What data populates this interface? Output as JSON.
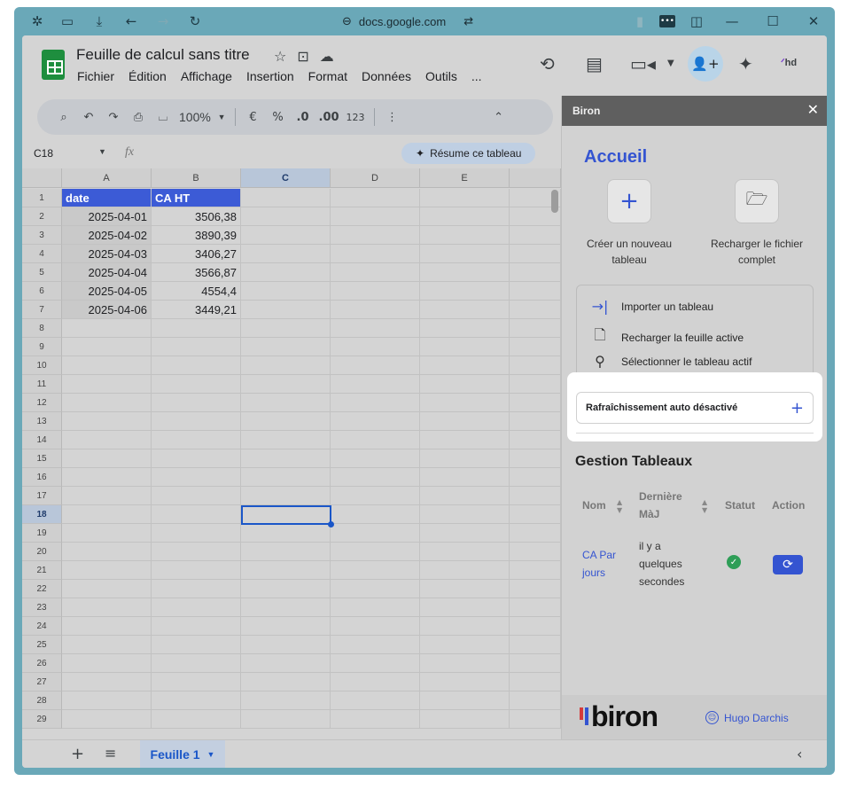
{
  "browser": {
    "url": "docs.google.com"
  },
  "doc": {
    "title": "Feuille de calcul sans titre",
    "menu": [
      "Fichier",
      "Édition",
      "Affichage",
      "Insertion",
      "Format",
      "Données",
      "Outils",
      "..."
    ],
    "hd_label": "hd"
  },
  "toolbar": {
    "zoom": "100%",
    "currency": "€",
    "percent": "%",
    "dec_less": ".0",
    "dec_more": ".00",
    "number_format": "123"
  },
  "formula": {
    "cell_ref": "C18",
    "fx": "fx",
    "summarize": "Résume ce tableau"
  },
  "grid": {
    "columns": [
      "A",
      "B",
      "C",
      "D",
      "E"
    ],
    "selected_column": "C",
    "rows": [
      "1",
      "2",
      "3",
      "4",
      "5",
      "6",
      "7",
      "8",
      "9",
      "10",
      "11",
      "12",
      "13",
      "14",
      "15",
      "16",
      "17",
      "18",
      "19",
      "20",
      "21",
      "22",
      "23",
      "24",
      "25",
      "26",
      "27",
      "28",
      "29"
    ],
    "selected_row": "18",
    "header": [
      "date",
      "CA HT"
    ],
    "data": [
      [
        "2025-04-01",
        "3506,38"
      ],
      [
        "2025-04-02",
        "3890,39"
      ],
      [
        "2025-04-03",
        "3406,27"
      ],
      [
        "2025-04-04",
        "3566,87"
      ],
      [
        "2025-04-05",
        "4554,4"
      ],
      [
        "2025-04-06",
        "3449,21"
      ]
    ]
  },
  "sheet_tabs": {
    "active": "Feuille 1"
  },
  "panel": {
    "title": "Biron",
    "accueil": "Accueil",
    "create_label_1": "Créer un nouveau",
    "create_label_2": "tableau",
    "reload_label_1": "Recharger le fichier",
    "reload_label_2": "complet",
    "actions": [
      "Importer un tableau",
      "Recharger la feuille active",
      "Sélectionner le tableau actif"
    ],
    "refresh": "Rafraîchissement auto désactivé",
    "gestion": "Gestion Tableaux",
    "table_headers": {
      "name": "Nom",
      "maj_1": "Dernière",
      "maj_2": "MàJ",
      "status": "Statut",
      "action": "Action"
    },
    "row": {
      "name_1": "CA Par",
      "name_2": "jours",
      "maj_1": "il y a",
      "maj_2": "quelques",
      "maj_3": "secondes"
    },
    "brand": "biron",
    "user": "Hugo Darchis"
  },
  "colors": {
    "accent": "#3454d1",
    "header_cell": "#3c5bd6",
    "status_ok": "#2e9e57",
    "window_frame": "#6aa8b8"
  }
}
